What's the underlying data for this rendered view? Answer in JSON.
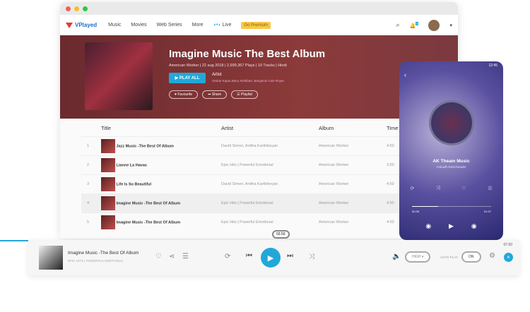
{
  "nav": {
    "logo": "VPlayed",
    "items": [
      "Music",
      "Movies",
      "Web Series",
      "More"
    ],
    "live": "Live",
    "premium": "Go Premium",
    "notif_count": "0"
  },
  "hero": {
    "title": "Imagine Music The Best Album",
    "meta": "American Worker  |  22 aug 2018  |  2,999,367 Plays  |  10 Tracks  |  Hindi",
    "play_all": "▶ PLAY ALL",
    "artist_label": "Artist",
    "artists": "Omkar Kapur,Barry Rothbart, Benjamin Cole Royer",
    "buttons": [
      "♥ Favourite",
      "➦ Share",
      "☰ Playlist"
    ]
  },
  "table": {
    "headers": [
      "Title",
      "Artist",
      "Album",
      "Time"
    ],
    "rows": [
      {
        "n": "1",
        "title": "Jazz Music -The Best Of Album",
        "artist": "David Simon, Anitha Karthikeyan",
        "album": "American Worker",
        "time": "4:50"
      },
      {
        "n": "2",
        "title": "Lianne La Havas",
        "artist": "Epic Hits | Powerful Emotional",
        "album": "American Worker",
        "time": "3:50"
      },
      {
        "n": "3",
        "title": "Life Is So Beautiful",
        "artist": "David Simon, Anitha Karthikeyan",
        "album": "American Worker",
        "time": "4:50"
      },
      {
        "n": "4",
        "title": "Imagine Music -The Best Of Album",
        "artist": "Epic Hits | Powerful Emotional",
        "album": "American Worker",
        "time": "4:50"
      },
      {
        "n": "5",
        "title": "Imagine Music -The Best Of Album",
        "artist": "Epic Hits | Powerful Emotional",
        "album": "American Worker",
        "time": "4:50"
      }
    ]
  },
  "phone": {
    "clock": "12:45",
    "title": "AK Theam Music",
    "subtitle": "Anirudh Ravichander",
    "elapsed": "00:35",
    "total": "01:37",
    "progress": 0.33
  },
  "player": {
    "title": "Imagine Music -The Best Of Album",
    "subtitle": "EPIC HITS | POWERFUL EMOTIONAL",
    "current": "03.50",
    "total": "07.50",
    "progress": 0.54,
    "quality": "HIGH",
    "autoplay_label": "AUTO PLAY",
    "autoplay": "ON"
  }
}
